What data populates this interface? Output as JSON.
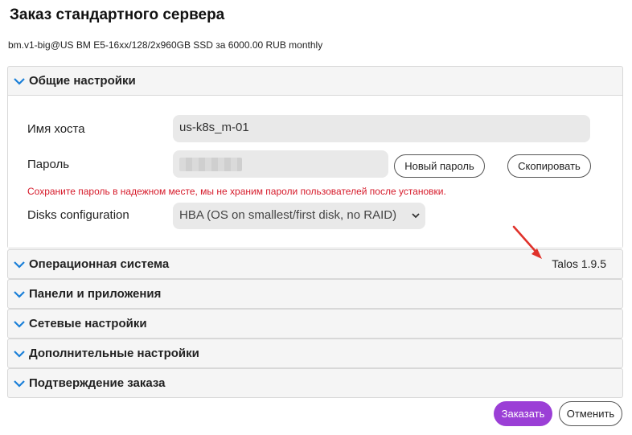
{
  "page": {
    "title": "Заказ стандартного сервера",
    "subtitle": "bm.v1-big@US BM E5-16xx/128/2x960GB SSD за 6000.00 RUB monthly"
  },
  "general": {
    "header": "Общие настройки",
    "hostname_label": "Имя хоста",
    "hostname_value": "us-k8s_m-01",
    "password_label": "Пароль",
    "new_password_button": "Новый пароль",
    "copy_button": "Скопировать",
    "warning": "Сохраните пароль в надежном месте, мы не храним пароли пользователей после установки.",
    "disks_label": "Disks configuration",
    "disks_value": "HBA (OS on smallest/first disk, no RAID)"
  },
  "sections": {
    "os": {
      "header": "Операционная система",
      "value": "Talos 1.9.5"
    },
    "panels": {
      "header": "Панели и приложения"
    },
    "network": {
      "header": "Сетевые настройки"
    },
    "additional": {
      "header": "Дополнительные настройки"
    },
    "confirm": {
      "header": "Подтверждение заказа"
    }
  },
  "actions": {
    "order": "Заказать",
    "cancel": "Отменить"
  },
  "colors": {
    "accent": "#9b3fd6",
    "chevron": "#1a7fd8",
    "warning": "#d61a2a",
    "annotation_arrow": "#e0322b"
  }
}
